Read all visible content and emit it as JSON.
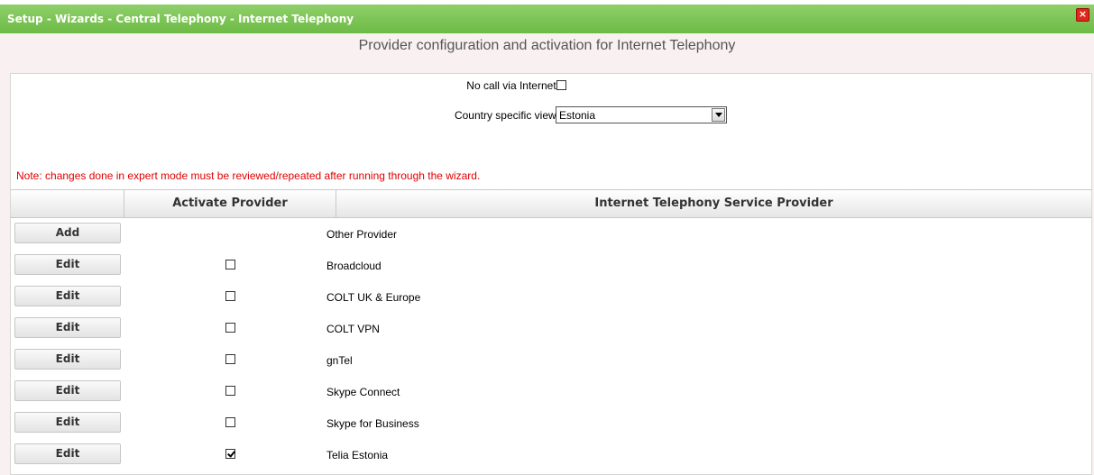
{
  "window": {
    "title": "Setup - Wizards - Central Telephony - Internet Telephony",
    "close_icon": "close-icon"
  },
  "page": {
    "heading": "Provider configuration and activation for Internet Telephony"
  },
  "form": {
    "no_call_label": "No call via Internet:",
    "no_call_checked": false,
    "country_label": "Country specific view:",
    "country_value": "Estonia",
    "note": "Note: changes done in expert mode must be reviewed/repeated after running through the wizard."
  },
  "table": {
    "columns": [
      "",
      "Activate Provider",
      "Internet Telephony Service Provider"
    ],
    "rows": [
      {
        "button": "Add",
        "has_checkbox": false,
        "checked": false,
        "provider": "Other Provider"
      },
      {
        "button": "Edit",
        "has_checkbox": true,
        "checked": false,
        "provider": "Broadcloud"
      },
      {
        "button": "Edit",
        "has_checkbox": true,
        "checked": false,
        "provider": "COLT UK & Europe"
      },
      {
        "button": "Edit",
        "has_checkbox": true,
        "checked": false,
        "provider": "COLT VPN"
      },
      {
        "button": "Edit",
        "has_checkbox": true,
        "checked": false,
        "provider": "gnTel"
      },
      {
        "button": "Edit",
        "has_checkbox": true,
        "checked": false,
        "provider": "Skype Connect"
      },
      {
        "button": "Edit",
        "has_checkbox": true,
        "checked": false,
        "provider": "Skype for Business"
      },
      {
        "button": "Edit",
        "has_checkbox": true,
        "checked": true,
        "provider": "Telia Estonia"
      }
    ]
  },
  "colors": {
    "titlebar": "#6dbb45",
    "note_text": "#e00000",
    "close_button": "#e0261b"
  }
}
